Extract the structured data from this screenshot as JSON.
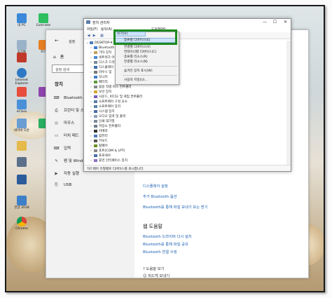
{
  "device_manager": {
    "title": "장치 관리자",
    "menus": [
      "파일(F)",
      "동작(A)",
      "보기(V)",
      "도움말(H)"
    ],
    "root_node": "DESKTOP-K",
    "tree": [
      "Bluetooth",
      "기타 장치",
      "네트워크 어",
      "디스크 드라",
      "디스플레이",
      "마우스 및",
      "모니터",
      "배터리",
      "범용 직렬 버스 컨트롤러",
      "보안 장치",
      "사운드, 비디오 및 게임 컨트롤러",
      "소프트웨어 구성 요소",
      "소프트웨어 장치",
      "시스템 장치",
      "오디오 입력 및 출력",
      "인쇄 대기열",
      "저장소 컨트롤러",
      "카메라",
      "컴퓨터",
      "키보드",
      "펌웨어",
      "포트(COM & LPT)",
      "프로세서",
      "휴먼 인터페이스 장치"
    ],
    "status": "하드웨어 유형별로 디바이스를 표시합니다.",
    "view_menu": {
      "items": [
        "종류별 디바이스(E)",
        "연결별 디바이스(V)",
        "컨테이너별 디바이스(C)",
        "종류별 리소스(R)",
        "연결별 리소스(N)",
        "숨겨진 장치 표시(W)",
        "사용자 지정(U)..."
      ],
      "checked_item": "종류별 디바이스(E)"
    }
  },
  "settings": {
    "title": "설정",
    "home": "홈",
    "search_placeholder": "설정 검색",
    "section": "장치",
    "sidebar_items": [
      "Bluetooth 및 기타",
      "프린터 및 스캐너",
      "마우스",
      "터치 패드",
      "입력",
      "펜 및 Windows",
      "자동 실행",
      "USB"
    ],
    "right_links": [
      "디스플레이 설정",
      "추가 Bluetooth 옵션",
      "Bluetooth를 통해 파일 보내기 또는 받기"
    ],
    "help_heading": "웹 도움말",
    "help_links": [
      "Bluetooth 드라이버 다시 설치",
      "Bluetooth를 통해 파일 공유",
      "Bluetooth 연결 수정"
    ],
    "bottom_links": [
      "도움말 보기",
      "피드백 보내기"
    ]
  },
  "desktop_icons": [
    "내 PC",
    "Evernote",
    "휴지통",
    "조아",
    "",
    "",
    "Internet Explorer",
    "",
    "",
    "eClass",
    "",
    "",
    "네이버 다운",
    "",
    "",
    "",
    "",
    "",
    "한글 2018",
    "",
    "Chrome"
  ],
  "colors": {
    "highlight_border": "#1d8a1d",
    "link": "#1a5fb4",
    "selection": "#cfe4f8"
  }
}
